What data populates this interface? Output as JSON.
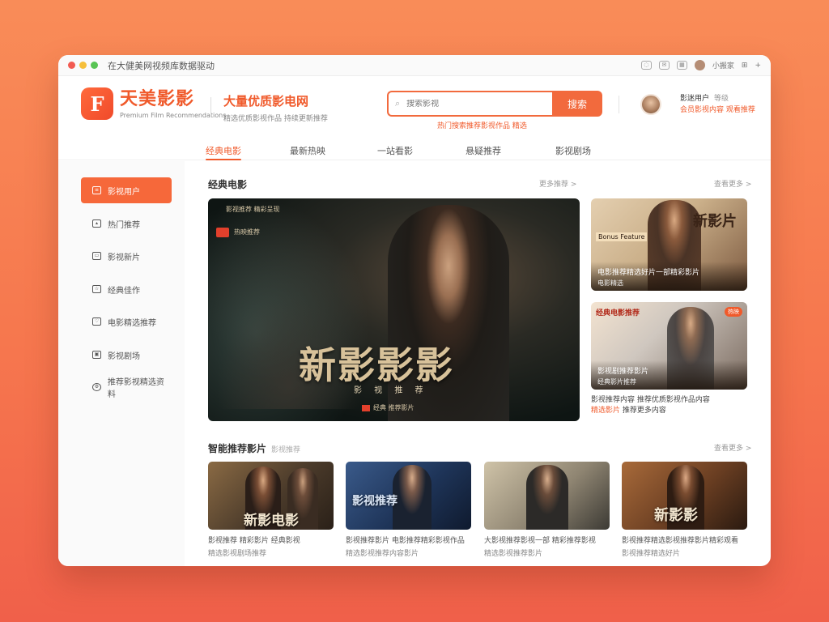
{
  "window": {
    "title": "在大健美网视频库数据驱动",
    "top_right": {
      "label": "小搬家",
      "extra": "+"
    }
  },
  "header": {
    "logo_mark": "F",
    "logo_name": "天美影影",
    "logo_sub": "Premium Film Recommendations",
    "slogan_main": "大量优质影电网",
    "slogan_sub": "精选优质影视作品 持续更新推荐",
    "search_placeholder": "搜索影视",
    "search_button": "搜索",
    "hot_words": "热门搜索推荐影视作品 精选"
  },
  "user": {
    "name": "影迷用户",
    "level": "等级",
    "vip": "会员影视内容 观看推荐"
  },
  "nav": {
    "tabs": [
      "经典电影",
      "最新热映",
      "一站看影",
      "悬疑推荐",
      "影视剧场"
    ]
  },
  "sidebar": {
    "items": [
      {
        "label": "影视用户",
        "icon": "home-icon"
      },
      {
        "label": "热门推荐",
        "icon": "fire-icon"
      },
      {
        "label": "影视新片",
        "icon": "film-icon"
      },
      {
        "label": "经典佳作",
        "icon": "star-icon"
      },
      {
        "label": "电影精选推荐",
        "icon": "heart-icon"
      },
      {
        "label": "影视剧场",
        "icon": "tv-icon"
      },
      {
        "label": "推荐影视精选资料",
        "icon": "settings-icon"
      }
    ]
  },
  "main": {
    "section1_title": "经典电影",
    "section1_more1": "更多推荐 >",
    "section1_more2": "查看更多 >",
    "hero": {
      "small_text": "影视推荐 精彩呈现",
      "small_text2": "热映推荐",
      "title": "新影影影",
      "subtitle": "影 视 推 荐",
      "footer": "经典 推荐影片"
    },
    "card1": {
      "title": "新影片",
      "tag": "Bonus Feature",
      "caption1": "电影推荐精选好片一部精彩影片",
      "caption2": "电影精选"
    },
    "card2": {
      "head": "经典电影推荐",
      "badge": "热映",
      "caption1": "影视剧推荐影片",
      "caption2": "经典影片推荐",
      "text1": "影视推荐内容 推荐优质影视作品内容",
      "text2_hl": "精选影片",
      "text2": "推荐更多内容"
    },
    "section2_title": "智能推荐影片",
    "section2_sub": "影视推荐",
    "section2_more": "查看更多 >",
    "rec": [
      {
        "title": "新影电影",
        "line1": "影视推荐 精彩影片  经典影视",
        "line2": "精选影视剧场推荐"
      },
      {
        "title": "影视推荐",
        "line1": "影视推荐影片  电影推荐精彩影视作品",
        "line2": "精选影视推荐内容影片"
      },
      {
        "title": "",
        "line1": "大影视推荐影视一部 精彩推荐影视",
        "line2": "精选影视推荐影片"
      },
      {
        "title": "新影影",
        "line1": "影视推荐精选影视推荐影片精彩观看",
        "line2": "影视推荐精选好片"
      }
    ]
  },
  "colors": {
    "accent": "#f05a2b",
    "accent_button": "#f26a3d",
    "background_top": "#f98c58",
    "background_bottom": "#f0604a"
  }
}
